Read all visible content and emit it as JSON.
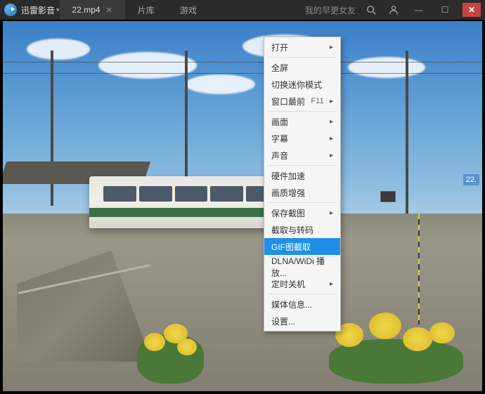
{
  "app": {
    "name": "迅雷影音"
  },
  "tabs": {
    "items": [
      {
        "label": "22.mp4",
        "active": true,
        "closable": true
      },
      {
        "label": "片库",
        "active": false
      },
      {
        "label": "游戏",
        "active": false
      }
    ]
  },
  "header": {
    "link": "我的早更女友"
  },
  "badge": {
    "text": "22."
  },
  "menu": {
    "items": [
      {
        "label": "打开",
        "submenu": true
      },
      {
        "sep": true
      },
      {
        "label": "全屏"
      },
      {
        "label": "切换迷你模式"
      },
      {
        "label": "窗口最前",
        "shortcut": "F11",
        "submenu": true
      },
      {
        "sep": true
      },
      {
        "label": "画面",
        "submenu": true
      },
      {
        "label": "字幕",
        "submenu": true
      },
      {
        "label": "声音",
        "submenu": true
      },
      {
        "sep": true
      },
      {
        "label": "硬件加速"
      },
      {
        "label": "画质增强"
      },
      {
        "sep": true
      },
      {
        "label": "保存截图",
        "submenu": true
      },
      {
        "label": "截取与转码"
      },
      {
        "label": "GIF图截取",
        "highlight": true
      },
      {
        "sep": true
      },
      {
        "label": "DLNA/WiDi 播放..."
      },
      {
        "label": "定时关机",
        "submenu": true
      },
      {
        "sep": true
      },
      {
        "label": "媒体信息..."
      },
      {
        "label": "设置..."
      }
    ]
  }
}
